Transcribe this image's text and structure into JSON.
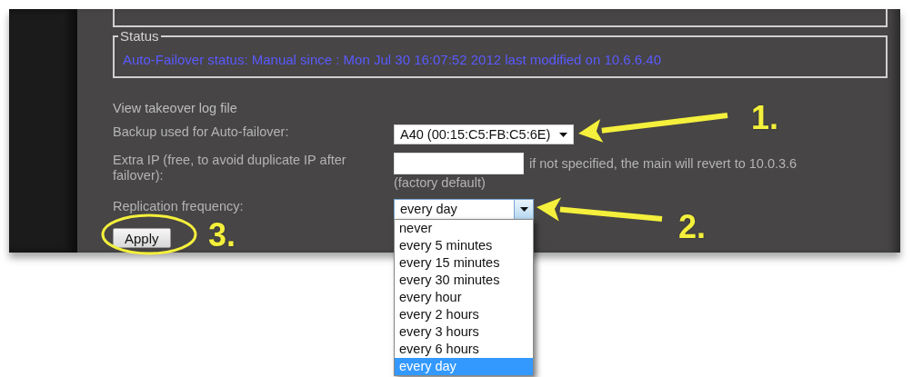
{
  "status": {
    "legend": "Status",
    "text": "Auto-Failover status: Manual since : Mon Jul 30 16:07:52 2012 last modified on 10.6.6.40"
  },
  "form": {
    "log_link": "View takeover log file",
    "backup": {
      "label": "Backup used for Auto-failover:",
      "value": "A40 (00:15:C5:FB:C5:6E)"
    },
    "extra_ip": {
      "label": "Extra IP (free, to avoid duplicate IP after failover):",
      "hint": "if not specified, the main will revert to 10.0.3.6",
      "hint_note": "(factory default)"
    },
    "replication": {
      "label": "Replication frequency:",
      "value": "every day",
      "expanded": true,
      "options": [
        {
          "label": "never",
          "selected": false
        },
        {
          "label": "every 5 minutes",
          "selected": false
        },
        {
          "label": "every 15 minutes",
          "selected": false
        },
        {
          "label": "every 30 minutes",
          "selected": false
        },
        {
          "label": "every hour",
          "selected": false
        },
        {
          "label": "every 2 hours",
          "selected": false
        },
        {
          "label": "every 3 hours",
          "selected": false
        },
        {
          "label": "every 6 hours",
          "selected": false
        },
        {
          "label": "every day",
          "selected": true
        }
      ]
    },
    "apply_button": "Apply"
  },
  "annotations": [
    {
      "kind": "arrow",
      "label": "1."
    },
    {
      "kind": "arrow",
      "label": "2."
    },
    {
      "kind": "ellipse",
      "label": "3."
    }
  ]
}
